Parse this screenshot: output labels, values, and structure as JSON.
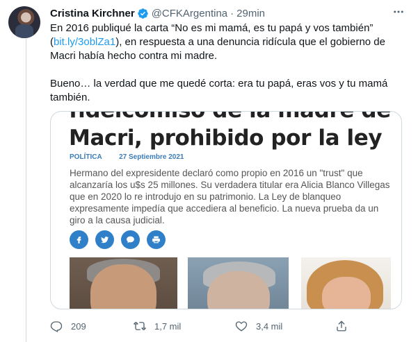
{
  "author": {
    "name": "Cristina Kirchner",
    "handle": "@CFKArgentina",
    "separator": "·",
    "time": "29min"
  },
  "tweet": {
    "para1_before": "En 2016 publiqué la carta “No es mi mamá, es tu papá y vos también” (",
    "para1_link": "bit.ly/3oblZa1",
    "para1_after": "), en respuesta a una denuncia ridícula que el gobierno de Macri había hecho contra mi madre.",
    "para2": "Bueno… la verdad que me quedé corta: era tu papá, eras vos y tu mamá también."
  },
  "card": {
    "headline_line1": "fideicomiso de la madre de",
    "headline_line2": "Macri, prohibido por la ley",
    "section": "POLÍTICA",
    "date": "27 Septiembre 2021",
    "summary": "Hermano del expresidente declaró como propio en 2016 un \"trust\" que alcanzaría los u$s 25 millones. Su verdadera titular era Alicia Blanco Villegas que en 2020 lo re introdujo en su patrimonio. La Ley de blanqueo expresamente impedía que accediera al beneficio. La nueva prueba da un giro a la causa judicial."
  },
  "actions": {
    "replies": "209",
    "retweets": "1,7 mil",
    "likes": "3,4 mil"
  },
  "colors": {
    "accent": "#1d9bf0",
    "muted": "#536471",
    "share_button": "#2f80c9"
  },
  "icons": [
    "verified-badge-icon",
    "more-icon",
    "facebook-icon",
    "twitter-icon",
    "chat-icon",
    "print-icon",
    "reply-icon",
    "retweet-icon",
    "like-icon",
    "share-icon"
  ]
}
